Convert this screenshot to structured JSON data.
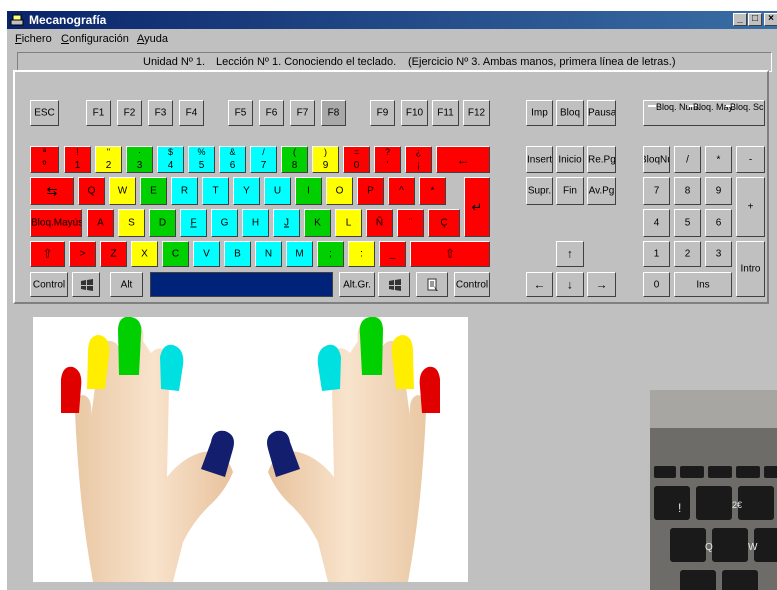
{
  "window": {
    "title": "Mecanografía"
  },
  "menu": [
    "Fichero",
    "Configuración",
    "Ayuda"
  ],
  "status": {
    "unit": "Unidad Nº 1.",
    "lesson": "Lección Nº 1. Conociendo el teclado.",
    "exercise": "(Ejercicio Nº 3. Ambas manos, primera línea de letras.)"
  },
  "colors": {
    "red": "#ff0000",
    "yellow": "#ffff00",
    "green": "#00d000",
    "cyan": "#00ffff",
    "gray": "#c0c0c0",
    "dark_gray": "#a0a0a0",
    "space": "#00237a"
  },
  "keys": {
    "function": [
      "ESC",
      "F1",
      "F2",
      "F3",
      "F4",
      "F5",
      "F6",
      "F7",
      "F8",
      "F9",
      "F10",
      "F11",
      "F12",
      "Imp",
      "Bloq",
      "Pausa"
    ],
    "locks": [
      "Bloq. Num.",
      "Bloq. May.",
      "Bloq. Scroll"
    ],
    "num_row": [
      {
        "main": "ª",
        "sub": "º",
        "color": "red"
      },
      {
        "main": "!",
        "sub": "1",
        "color": "red"
      },
      {
        "main": "\"",
        "sub": "2",
        "color": "yellow"
      },
      {
        "main": "·",
        "sub": "3",
        "color": "green"
      },
      {
        "main": "$",
        "sub": "4",
        "color": "cyan"
      },
      {
        "main": "%",
        "sub": "5",
        "color": "cyan"
      },
      {
        "main": "&",
        "sub": "6",
        "color": "cyan"
      },
      {
        "main": "/",
        "sub": "7",
        "color": "cyan"
      },
      {
        "main": "(",
        "sub": "8",
        "color": "green"
      },
      {
        "main": ")",
        "sub": "9",
        "color": "yellow"
      },
      {
        "main": "=",
        "sub": "0",
        "color": "red"
      },
      {
        "main": "?",
        "sub": "'",
        "color": "red"
      },
      {
        "main": "¿",
        "sub": "¡",
        "color": "red"
      },
      {
        "main": "←",
        "sub": "",
        "color": "red"
      }
    ],
    "q_row": [
      "⇆",
      "Q",
      "W",
      "E",
      "R",
      "T",
      "Y",
      "U",
      "I",
      "O",
      "P",
      "^",
      "*",
      "↵"
    ],
    "a_row": [
      "Bloq.Mayús",
      "A",
      "S",
      "D",
      "F",
      "G",
      "H",
      "J",
      "K",
      "L",
      "Ñ",
      "¨",
      "Ç"
    ],
    "z_row": [
      "⇧",
      ">",
      "Z",
      "X",
      "C",
      "V",
      "B",
      "N",
      "M",
      ";",
      ":",
      "_",
      "⇧"
    ],
    "bottom_row": [
      "Control",
      "Alt",
      "Alt.Gr.",
      "Control"
    ],
    "nav": [
      "Insert",
      "Inicio",
      "Re.Pg",
      "Supr.",
      "Fin",
      "Av.Pg"
    ],
    "arrows": [
      "↑",
      "←",
      "↓",
      "→"
    ],
    "numpad": [
      "BloqNum",
      "/",
      "*",
      "-",
      "7",
      "8",
      "9",
      "+",
      "4",
      "5",
      "6",
      "1",
      "2",
      "3",
      "Intro",
      "0",
      "Ins"
    ]
  }
}
